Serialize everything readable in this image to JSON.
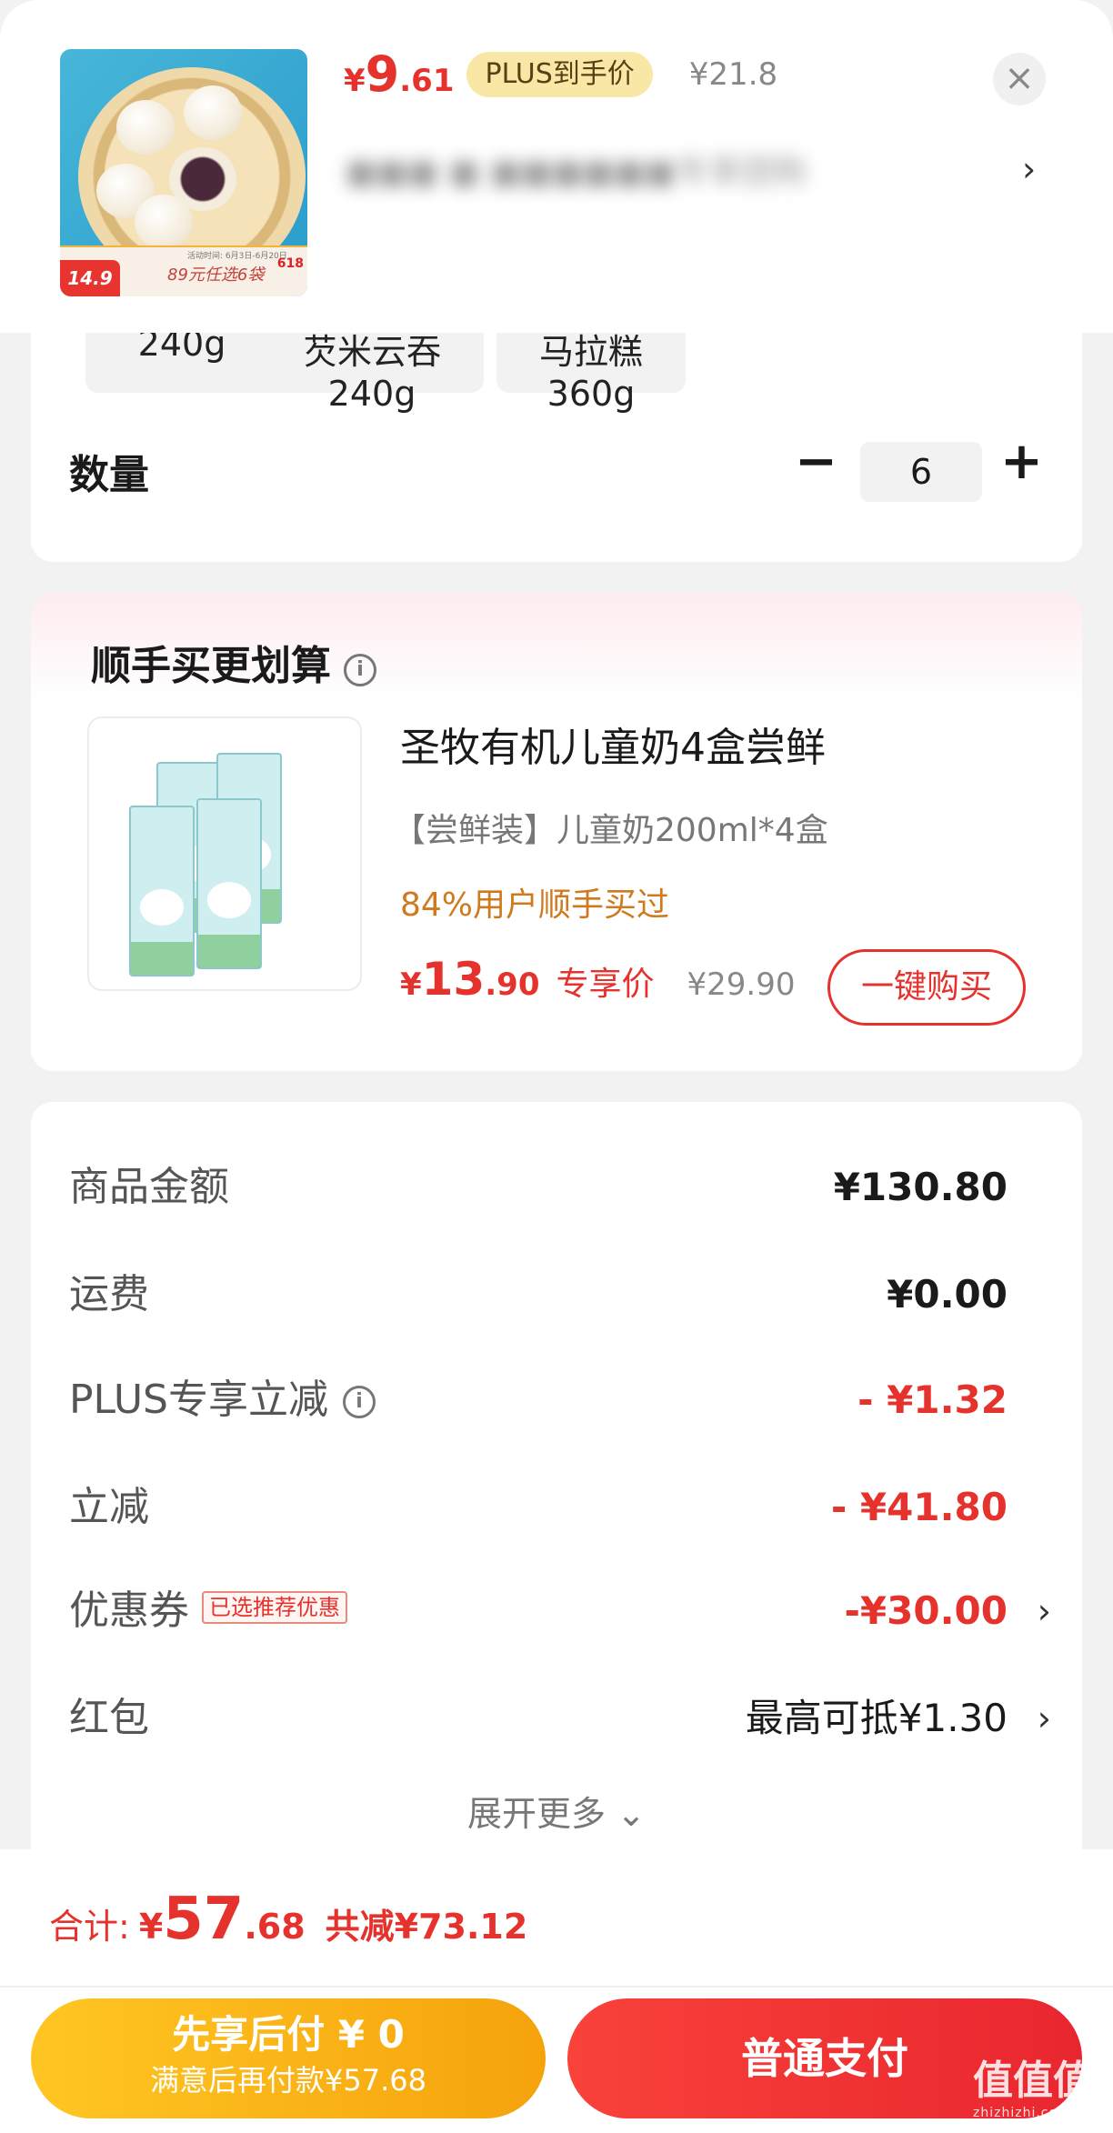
{
  "header": {
    "price_currency": "¥",
    "price_int": "9",
    "price_dec": ".61",
    "plus_label": "PLUS到手价",
    "original_price": "¥21.8",
    "close_icon": "close-icon",
    "title_blurred": "■■■ ■ ■■■■■■专享团购",
    "chevron": "›",
    "thumb": {
      "promo_price": "14.9",
      "promo_text": "89元任选6袋",
      "promo_date": "活动时间: 6月3日-6月20日",
      "badge": "618"
    }
  },
  "specs": [
    {
      "label": "240g"
    },
    {
      "label": "芡米云吞 240g"
    },
    {
      "label": "马拉糕 360g"
    }
  ],
  "quantity": {
    "label": "数量",
    "minus": "−",
    "value": "6",
    "plus": "+"
  },
  "upsell": {
    "title": "顺手买更划算",
    "product_name": "圣牧有机儿童奶4盒尝鲜",
    "spec": "【尝鲜装】儿童奶200ml*4盒",
    "stat": "84%用户顺手买过",
    "price_currency": "¥",
    "price_int": "13",
    "price_dec": ".90",
    "exclusive_label": "专享价",
    "original_price": "¥29.90",
    "buy_button": "一键购买"
  },
  "summary": {
    "rows": [
      {
        "label": "商品金额",
        "value": "¥130.80"
      },
      {
        "label": "运费",
        "value": "¥0.00"
      },
      {
        "label": "PLUS专享立减",
        "value": "- ¥1.32"
      },
      {
        "label": "立减",
        "value": "- ¥41.80"
      },
      {
        "label": "优惠券",
        "tag": "已选推荐优惠",
        "value": "-¥30.00"
      },
      {
        "label": "红包",
        "value": "最高可抵¥1.30"
      }
    ],
    "expand_label": "展开更多 ⌄"
  },
  "footer": {
    "total_label": "合计:",
    "total_currency": "¥",
    "total_int": "57",
    "total_dec": ".68",
    "savings": "共减¥73.12",
    "pay_later_title": "先享后付 ¥ 0",
    "pay_later_sub": "满意后再付款¥57.68",
    "pay_button": "普通支付"
  },
  "watermark": {
    "text": "值值值",
    "url": "zhizhizhi.com"
  },
  "colors": {
    "accent_red": "#e5322d",
    "plus_pill": "#f8e7a5",
    "orange_stat": "#d07a1f",
    "pay_later": "#f5a30c"
  }
}
